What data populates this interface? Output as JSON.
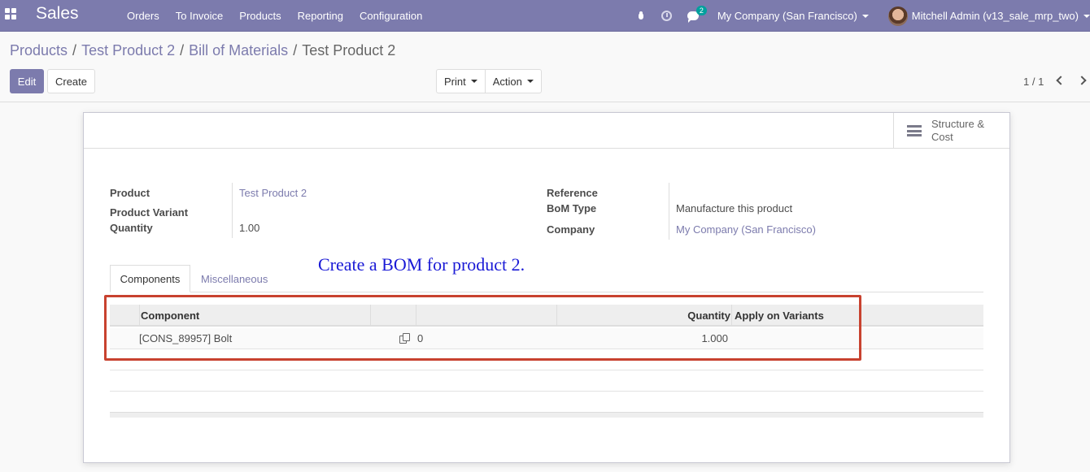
{
  "navbar": {
    "app_name": "Sales",
    "menu": [
      "Orders",
      "To Invoice",
      "Products",
      "Reporting",
      "Configuration"
    ],
    "messages_badge": "2",
    "company": "My Company (San Francisco)",
    "user": "Mitchell Admin (v13_sale_mrp_two)"
  },
  "breadcrumb": {
    "items": [
      "Products",
      "Test Product 2",
      "Bill of Materials"
    ],
    "separator": "/",
    "current": "Test Product 2"
  },
  "buttons": {
    "edit": "Edit",
    "create": "Create",
    "print": "Print",
    "action": "Action"
  },
  "pager": {
    "value": "1 / 1"
  },
  "stat_button": {
    "line1": "Structure &",
    "line2": "Cost"
  },
  "form": {
    "product_label": "Product",
    "product_value": "Test Product 2",
    "variant_label": "Product Variant",
    "quantity_label": "Quantity",
    "quantity_value": "1.00",
    "reference_label": "Reference",
    "bom_type_label": "BoM Type",
    "bom_type_value": "Manufacture this product",
    "company_label": "Company",
    "company_value": "My Company (San Francisco)"
  },
  "annotation": "Create a BOM for product 2.",
  "tabs": [
    "Components",
    "Miscellaneous"
  ],
  "table": {
    "headers": {
      "component": "Component",
      "quantity": "Quantity",
      "apply_on_variants": "Apply on Variants"
    },
    "rows": [
      {
        "component": "[CONS_89957] Bolt",
        "operation": "0",
        "quantity": "1.000"
      }
    ]
  },
  "colors": {
    "brand": "#7c7bad",
    "highlight": "#c8422f",
    "annotation": "#1a1ad6"
  },
  "icons": [
    "apps-grid-icon",
    "bug-icon",
    "clock-icon",
    "chat-icon",
    "caret-down-icon",
    "chevron-left-icon",
    "chevron-right-icon",
    "bars-icon",
    "copy-icon"
  ]
}
